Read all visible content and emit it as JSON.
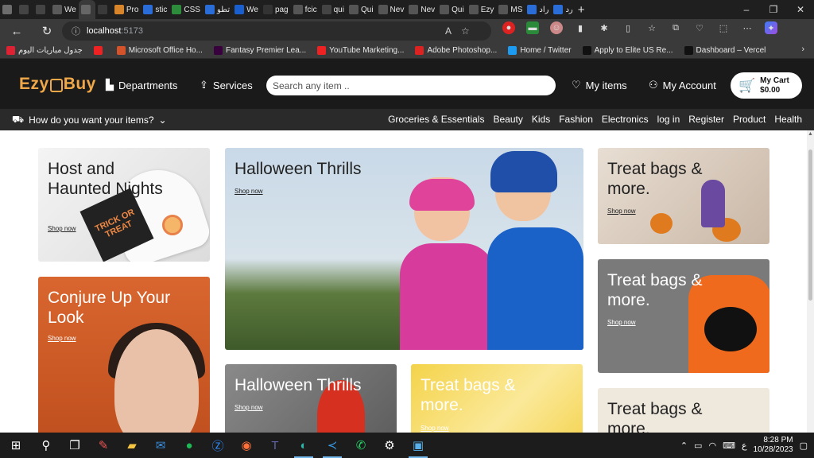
{
  "browser": {
    "tabs": [
      {
        "icon": "user-avatar-icon",
        "label": "",
        "color": "#6d6d6d"
      },
      {
        "icon": "workspaces-icon",
        "label": "",
        "color": "#444"
      },
      {
        "icon": "tab-actions-icon",
        "label": "",
        "color": "#444"
      },
      {
        "icon": "site-icon",
        "label": "We",
        "color": "#5a5a5a"
      },
      {
        "icon": "site-icon",
        "label": "",
        "color": "#666",
        "active": true
      },
      {
        "icon": "close-icon",
        "label": "",
        "color": "#3a3a3a"
      },
      {
        "icon": "site-icon",
        "label": "Pro",
        "color": "#d8842a"
      },
      {
        "icon": "search-icon",
        "label": "stic",
        "color": "#2a6cd8"
      },
      {
        "icon": "site-icon",
        "label": "CSS",
        "color": "#2c8c3c"
      },
      {
        "icon": "site-icon",
        "label": "تطو",
        "color": "#2a6cd8"
      },
      {
        "icon": "site-icon",
        "label": "We",
        "color": "#1a5fd0"
      },
      {
        "icon": "github-icon",
        "label": "pag",
        "color": "#333"
      },
      {
        "icon": "doc-icon",
        "label": "fcic",
        "color": "#555"
      },
      {
        "icon": "site-icon",
        "label": "qui",
        "color": "#444"
      },
      {
        "icon": "site-icon",
        "label": "Qui",
        "color": "#555"
      },
      {
        "icon": "site-icon",
        "label": "Nev",
        "color": "#555"
      },
      {
        "icon": "site-icon",
        "label": "Nev",
        "color": "#555"
      },
      {
        "icon": "site-icon",
        "label": "Qui",
        "color": "#555"
      },
      {
        "icon": "site-icon",
        "label": "Ezy",
        "color": "#555"
      },
      {
        "icon": "site-icon",
        "label": "MS",
        "color": "#555"
      },
      {
        "icon": "search-icon",
        "label": "راد",
        "color": "#2a6cd8"
      },
      {
        "icon": "search-icon",
        "label": "رد",
        "color": "#2a6cd8"
      }
    ],
    "new_tab": "+",
    "window_controls": {
      "minimize": "–",
      "restore": "❐",
      "close": "✕"
    },
    "url": {
      "host": "localhost",
      "port": ":5173"
    },
    "bookmarks": [
      {
        "label": "جدول مباريات اليوم",
        "color": "#d23"
      },
      {
        "label": "",
        "color": "#e22"
      },
      {
        "label": "Microsoft Office Ho...",
        "color": "#d4532a"
      },
      {
        "label": "Fantasy Premier Lea...",
        "color": "#38003c"
      },
      {
        "label": "YouTube Marketing...",
        "color": "#e22"
      },
      {
        "label": "Adobe Photoshop...",
        "color": "#d22"
      },
      {
        "label": "Home / Twitter",
        "color": "#1d9bf0"
      },
      {
        "label": "Apply to Elite US Re...",
        "color": "#111"
      },
      {
        "label": "Dashboard – Vercel",
        "color": "#111"
      }
    ]
  },
  "site": {
    "logo": {
      "part1": "Ezy",
      "part2": "Buy"
    },
    "nav": {
      "departments": "Departments",
      "services": "Services",
      "my_items": "My items",
      "my_account": "My Account"
    },
    "search": {
      "placeholder": "Search any item .."
    },
    "cart": {
      "label": "My Cart",
      "amount": "$0.00"
    },
    "subnav": {
      "prompt": "How do you want your items?",
      "categories": [
        "Groceries & Essentials",
        "Beauty",
        "Kids",
        "Fashion",
        "Electronics",
        "log in",
        "Register",
        "Product",
        "Health"
      ]
    },
    "cards": {
      "c1": {
        "title": "Host and Haunted Nights",
        "link": "Shop now"
      },
      "c2": {
        "title": "Halloween Thrills",
        "link": "Shop now"
      },
      "c3": {
        "title": "Treat bags & more.",
        "link": "Shop now"
      },
      "c4": {
        "title": "Conjure Up Your Look",
        "link": "Shop now"
      },
      "c5": {
        "title": "Treat bags & more.",
        "link": "Shop now"
      },
      "c6": {
        "title": "Halloween Thrills",
        "link": "Shop now"
      },
      "c7": {
        "title": "Treat bags & more.",
        "link": "Shop now"
      },
      "c8": {
        "title": "Treat bags & more."
      }
    },
    "napkin_text": "TRICK OR TREAT"
  },
  "taskbar": {
    "time": "8:28 PM",
    "date": "10/28/2023",
    "lang": "ع"
  }
}
